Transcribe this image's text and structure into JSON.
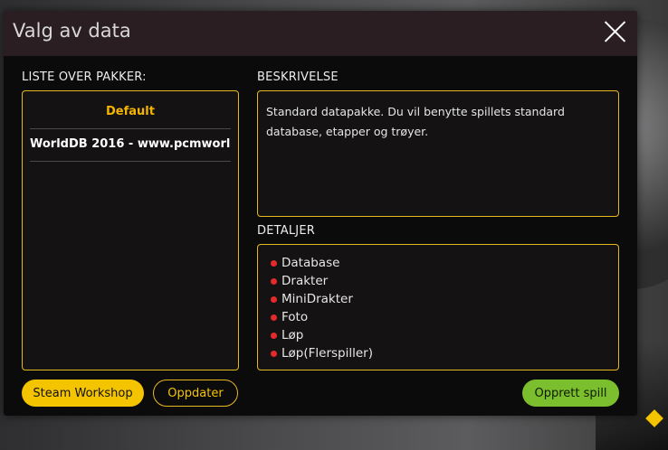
{
  "dialog": {
    "title": "Valg av data",
    "close_icon": "close-icon"
  },
  "packages": {
    "label": "LISTE OVER PAKKER:",
    "items": [
      {
        "label": "Default",
        "selected": true
      },
      {
        "label": "WorldDB 2016 - www.pcmworl..",
        "selected": false
      }
    ]
  },
  "description": {
    "label": "BESKRIVELSE",
    "text": "Standard datapakke. Du vil benytte spillets standard database, etapper og trøyer."
  },
  "details": {
    "label": "DETALJER",
    "items": [
      "Database",
      "Drakter",
      "MiniDrakter",
      "Foto",
      "Løp",
      "Løp(Flerspiller)"
    ]
  },
  "buttons": {
    "steam_workshop": "Steam Workshop",
    "update": "Oppdater",
    "create_game": "Opprett spill"
  },
  "colors": {
    "accent": "#f5c400",
    "border": "#e8b820",
    "create": "#7bbf2e",
    "bullet": "#e52a2a"
  }
}
